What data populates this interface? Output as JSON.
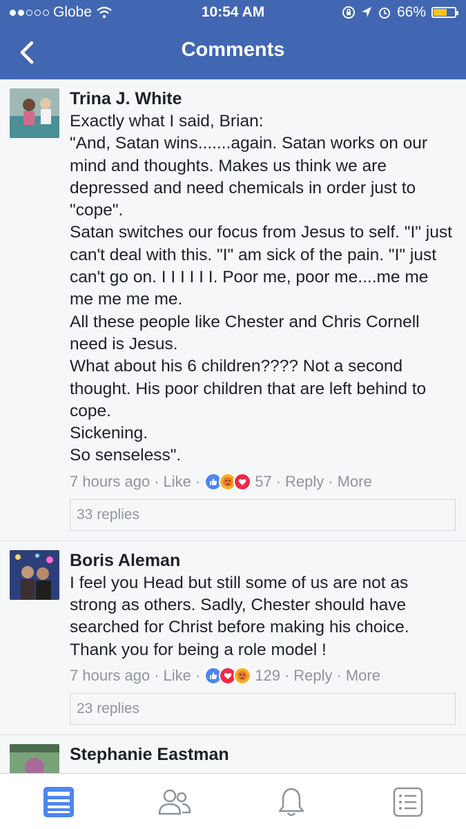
{
  "status_bar": {
    "carrier": "Globe",
    "time": "10:54 AM",
    "battery": "66%"
  },
  "nav": {
    "title": "Comments"
  },
  "comments": [
    {
      "author": "Trina J. White",
      "text": "Exactly what I said, Brian:\n\"And, Satan wins.......again. Satan works on our mind and thoughts. Makes us think we are depressed and need chemicals in order just to \"cope\".\nSatan switches our focus from Jesus to self. \"I\" just can't deal with this. \"I\" am sick of the pain. \"I\" just can't go on. I I I I I I. Poor me, poor me....me me me me me me.\nAll these people like Chester and Chris Cornell need is Jesus.\nWhat about his 6 children???? Not a second thought. His poor children that are left behind to cope.\nSickening.\nSo senseless\".",
      "time": "7 hours ago",
      "like": "Like",
      "reaction_count": "57",
      "reply": "Reply",
      "more": "More",
      "replies": "33 replies"
    },
    {
      "author": "Boris Aleman",
      "text": "I feel you Head but still some of us are not as strong as others. Sadly, Chester should have searched for Christ before making his choice. Thank you for being a role model !",
      "time": "7 hours ago",
      "like": "Like",
      "reaction_count": "129",
      "reply": "Reply",
      "more": "More",
      "replies": "23 replies"
    },
    {
      "author": "Stephanie Eastman"
    }
  ],
  "colors": {
    "brand": "#4267b2",
    "meta": "#90949c",
    "text": "#1d2129"
  },
  "tabs": [
    "news-feed-icon",
    "friends-icon",
    "notifications-icon",
    "menu-icon"
  ]
}
